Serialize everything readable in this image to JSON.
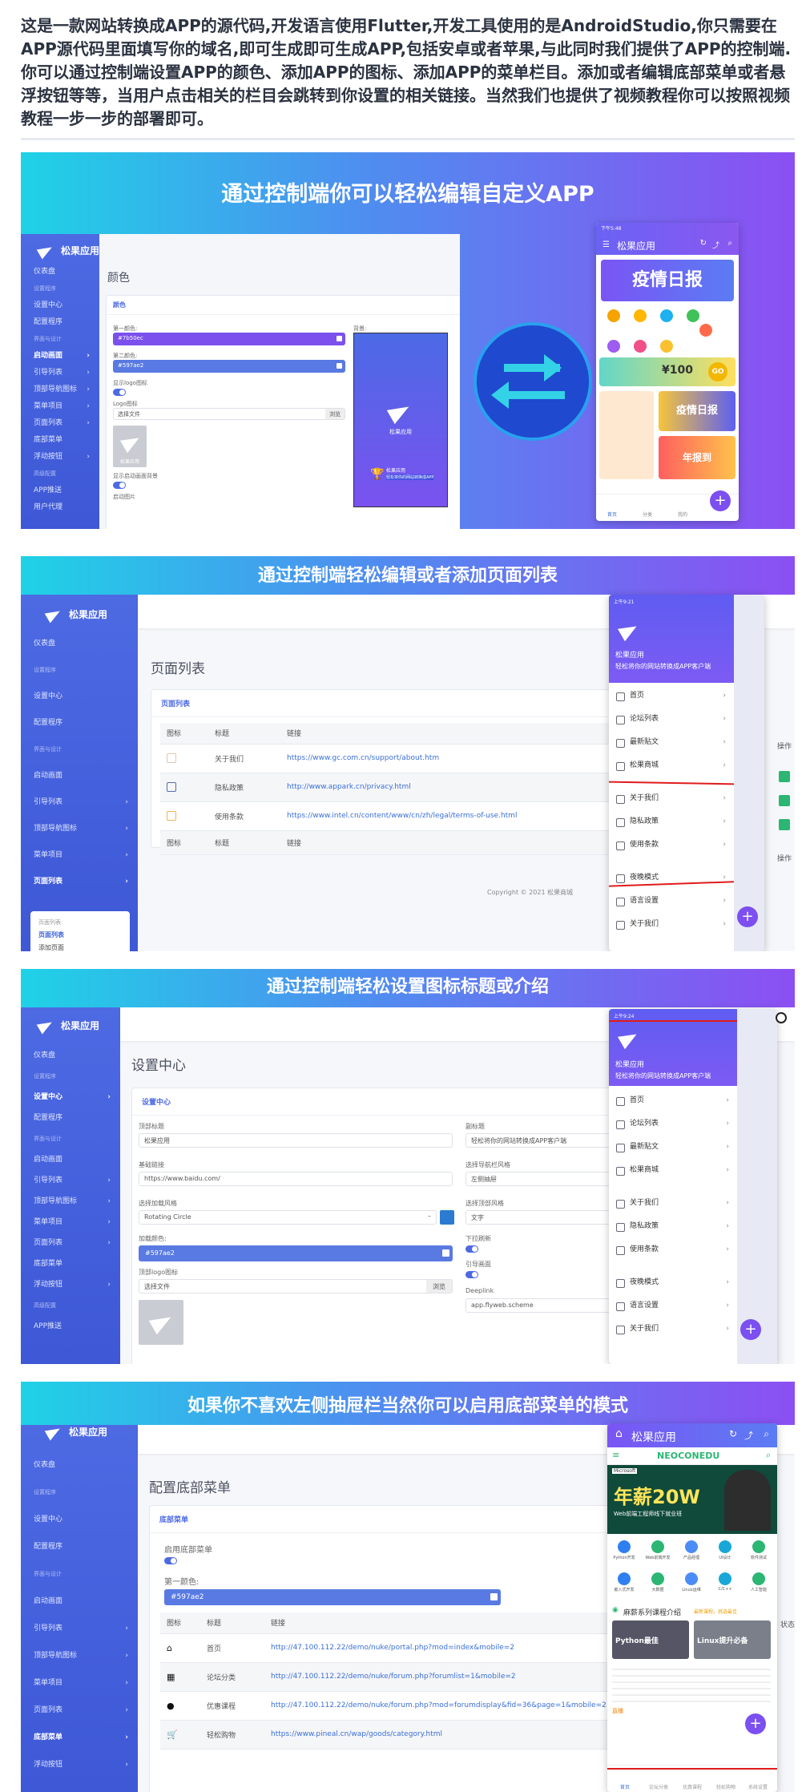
{
  "intro": {
    "text": "这是一款网站转换成APP的源代码,开发语言使用Flutter,开发工具使用的是AndroidStudio,你只需要在APP源代码里面填写你的域名,即可生成即可生成APP,包括安卓或者苹果,与此同时我们提供了APP的控制端.你可以通过控制端设置APP的颜色、添加APP的图标、添加APP的菜单栏目。添加或者编辑底部菜单或者悬浮按钮等等，当用户点击相关的栏目会跳转到你设置的相关链接。当然我们也提供了视频教程你可以按照视频教程一步一步的部署即可。"
  },
  "colors": {
    "brand": "#4d6ae3",
    "accent": "#7b4ff0",
    "fill_color": "#597ae2",
    "fill_purple": "#7b50ec"
  },
  "panel1": {
    "title": "通过控制端你可以轻松编辑自定义APP",
    "brand": "松果应用",
    "nav": [
      {
        "label": "仪表盘",
        "kind": "item"
      },
      {
        "label": "设置程序",
        "kind": "grp"
      },
      {
        "label": "设置中心",
        "kind": "item"
      },
      {
        "label": "配置程序",
        "kind": "item"
      },
      {
        "label": "界面与设计",
        "kind": "grp"
      },
      {
        "label": "启动画面",
        "kind": "act"
      },
      {
        "label": "引导列表",
        "kind": "sub"
      },
      {
        "label": "顶部导航图标",
        "kind": "sub"
      },
      {
        "label": "菜单项目",
        "kind": "sub"
      },
      {
        "label": "页面列表",
        "kind": "sub"
      },
      {
        "label": "底部菜单",
        "kind": "item"
      },
      {
        "label": "浮动按钮",
        "kind": "sub"
      },
      {
        "label": "高级配置",
        "kind": "grp"
      },
      {
        "label": "APP推送",
        "kind": "item"
      },
      {
        "label": "用户代理",
        "kind": "item"
      }
    ],
    "page_title": "颜色",
    "card_head": "颜色",
    "label_first_color": "第一颜色:",
    "value_first_color": "#7b50ec",
    "label_second_color": "第二颜色:",
    "value_second_color": "#597ae2",
    "label_show_logo": "显示logo图标",
    "label_logo_icon": "Logo图标",
    "file_placeholder": "选择文件",
    "browse": "浏览",
    "logo_caption": "松果应用",
    "label_show_bg": "显示启动画面背景",
    "label_splash_img": "启动图片",
    "label_bg": "背景:",
    "preview_caption": "松果应用",
    "preview_sub": "松果应用",
    "preview_sub2": "轻松将你的网站转换成APP",
    "phone_title": "松果应用",
    "phone_time": "下午5:48",
    "phone_banner": "疫情日报",
    "phone_coupon": "¥100",
    "phone_coupon_btn": "GO",
    "phone_banner2": "疫情日报",
    "phone_banner3": "年报到",
    "phone_tabs": [
      "首页",
      "分类",
      "我的"
    ]
  },
  "panel2": {
    "title": "通过控制端轻松编辑或者添加页面列表",
    "brand": "松果应用",
    "nav": [
      {
        "label": "仪表盘",
        "kind": "item"
      },
      {
        "label": "设置程序",
        "kind": "grp"
      },
      {
        "label": "设置中心",
        "kind": "item"
      },
      {
        "label": "配置程序",
        "kind": "item"
      },
      {
        "label": "界面与设计",
        "kind": "grp"
      },
      {
        "label": "启动画面",
        "kind": "item"
      },
      {
        "label": "引导列表",
        "kind": "sub"
      },
      {
        "label": "顶部导航图标",
        "kind": "sub"
      },
      {
        "label": "菜单项目",
        "kind": "sub"
      },
      {
        "label": "页面列表",
        "kind": "act"
      }
    ],
    "subnav": [
      "页面列表:",
      "页面列表",
      "添加页面"
    ],
    "page_title": "页面列表",
    "card_head": "页面列表",
    "table_headers": [
      "图标",
      "标题",
      "链接"
    ],
    "rows": [
      {
        "title": "关于我们",
        "link": "https://www.gc.com.cn/support/about.htm"
      },
      {
        "title": "隐私政策",
        "link": "http://www.appark.cn/privacy.html"
      },
      {
        "title": "使用条款",
        "link": "https://www.intel.cn/content/www/cn/zh/legal/terms-of-use.html"
      }
    ],
    "footer_headers": [
      "图标",
      "标题",
      "链接"
    ],
    "copyright": "Copyright © 2021 松果商城",
    "ops_label": "操作",
    "ops_label2": "操作",
    "drawer_time": "上午9:21",
    "drawer_title": "松果应用",
    "drawer_sub": "轻松将你的网站转换成APP客户端",
    "drawer_items": [
      "首页",
      "论坛列表",
      "最新贴文",
      "松果商城",
      "",
      "关于我们",
      "隐私政策",
      "使用条款",
      "",
      "夜晚模式",
      "语言设置",
      "关于我们"
    ]
  },
  "panel3": {
    "title": "通过控制端轻松设置图标标题或介绍",
    "brand": "松果应用",
    "nav": [
      {
        "label": "仪表盘",
        "kind": "item"
      },
      {
        "label": "设置程序",
        "kind": "grp"
      },
      {
        "label": "设置中心",
        "kind": "act"
      },
      {
        "label": "配置程序",
        "kind": "item"
      },
      {
        "label": "界面与设计",
        "kind": "grp"
      },
      {
        "label": "启动画面",
        "kind": "item"
      },
      {
        "label": "引导列表",
        "kind": "sub"
      },
      {
        "label": "顶部导航图标",
        "kind": "sub"
      },
      {
        "label": "菜单项目",
        "kind": "sub"
      },
      {
        "label": "页面列表",
        "kind": "sub"
      },
      {
        "label": "底部菜单",
        "kind": "item"
      },
      {
        "label": "浮动按钮",
        "kind": "sub"
      },
      {
        "label": "高级配置",
        "kind": "grp"
      },
      {
        "label": "APP推送",
        "kind": "item"
      }
    ],
    "page_title": "设置中心",
    "card_head": "设置中心",
    "label_top_title": "顶部标题",
    "value_top_title": "松果应用",
    "label_subtitle": "副标题",
    "value_subtitle": "轻松将你的网站转换成APP客户端",
    "label_base_link": "基础链接",
    "value_base_link": "https://www.baidu.com/",
    "label_nav_style": "选择导航栏风格",
    "value_nav_style": "左侧抽屉",
    "label_loading_style": "选择加载风格",
    "value_loading_style": "Rotating Circle",
    "label_top_style": "选择顶部风格",
    "value_top_style": "文字",
    "label_load_color": "加载颜色:",
    "value_load_color": "#597ae2",
    "label_pull_refresh": "下拉刷新",
    "label_guide": "引导画面",
    "label_top_logo": "顶部logo图标",
    "file_placeholder": "选择文件",
    "browse": "浏览",
    "label_deeplink": "Deeplink",
    "value_deeplink": "app.flyweb.scheme",
    "drawer_time": "上午9:24",
    "drawer_title": "松果应用",
    "drawer_sub": "轻松将你的网站转换成APP客户端",
    "drawer_items": [
      "首页",
      "论坛列表",
      "最新贴文",
      "松果商城",
      "",
      "关于我们",
      "隐私政策",
      "使用条款",
      "",
      "夜晚模式",
      "语言设置",
      "关于我们"
    ]
  },
  "panel4": {
    "title": "如果你不喜欢左侧抽屉栏当然你可以启用底部菜单的模式",
    "brand": "松果应用",
    "nav": [
      {
        "label": "仪表盘",
        "kind": "item"
      },
      {
        "label": "设置程序",
        "kind": "grp"
      },
      {
        "label": "设置中心",
        "kind": "item"
      },
      {
        "label": "配置程序",
        "kind": "item"
      },
      {
        "label": "界面与设计",
        "kind": "grp"
      },
      {
        "label": "启动画面",
        "kind": "item"
      },
      {
        "label": "引导列表",
        "kind": "sub"
      },
      {
        "label": "顶部导航图标",
        "kind": "sub"
      },
      {
        "label": "菜单项目",
        "kind": "sub"
      },
      {
        "label": "页面列表",
        "kind": "sub"
      },
      {
        "label": "底部菜单",
        "kind": "act"
      },
      {
        "label": "浮动按钮",
        "kind": "sub"
      }
    ],
    "page_title": "配置底部菜单",
    "card_head": "底部菜单",
    "label_enable": "启用底部菜单",
    "label_first_color": "第一颜色:",
    "value_first_color": "#597ae2",
    "table_headers": [
      "图标",
      "标题",
      "链接"
    ],
    "rows": [
      {
        "title": "首页",
        "link": "http://47.100.112.22/demo/nuke/portal.php?mod=index&mobile=2"
      },
      {
        "title": "论坛分类",
        "link": "http://47.100.112.22/demo/nuke/forum.php?forumlist=1&mobile=2"
      },
      {
        "title": "优惠课程",
        "link": "http://47.100.112.22/demo/nuke/forum.php?mod=forumdisplay&fid=36&page=1&mobile=2"
      },
      {
        "title": "轻松购物",
        "link": "https://www.pineal.cn/wap/goods/category.html"
      }
    ],
    "status_label": "状态",
    "phone_title": "松果应用",
    "site_logo": "NEOCONEDU",
    "ad_brand": "Microsoft",
    "ad_title": "年薪20W",
    "ad_sub": "Web前端工程师线下就业班",
    "categories_row1": [
      "Python开发",
      "Web前端开发",
      "产品经理",
      "UI设计",
      "软件测试"
    ],
    "categories_row2": [
      "嵌入式开发",
      "大数据",
      "Linux运维",
      "C/C++",
      "人工智能"
    ],
    "section_title": "麻薪系列课程介绍",
    "section_more": "最新课程，挑选最佳",
    "course1": "Python最佳",
    "course2": "Linux提升必备",
    "course_tag": "直播",
    "bottom_tabs": [
      "首页",
      "论坛分类",
      "优惠课程",
      "轻松购物",
      "系统设置"
    ]
  }
}
